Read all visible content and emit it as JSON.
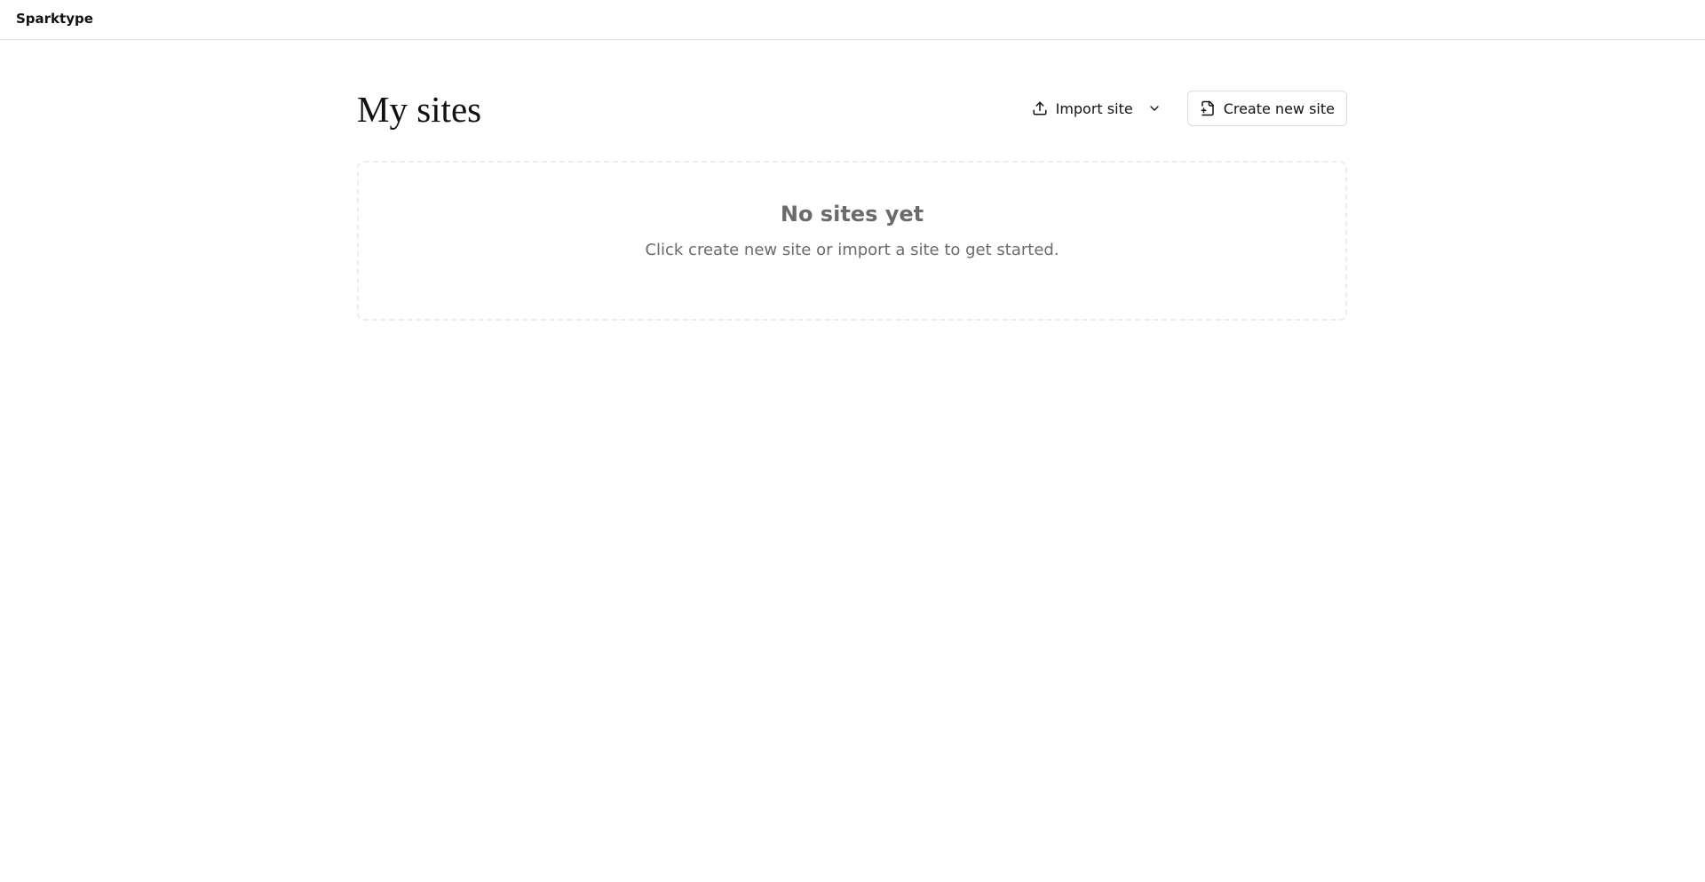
{
  "app": {
    "brand": "Sparktype"
  },
  "header": {
    "title": "My sites"
  },
  "actions": {
    "import_label": "Import site",
    "import_icon": "upload-icon",
    "import_menu_icon": "chevron-down-icon",
    "create_label": "Create new site",
    "create_icon": "file-plus-icon"
  },
  "empty_state": {
    "title": "No sites yet",
    "message": "Click create new site or import a site to get started."
  },
  "colors": {
    "text": "#111111",
    "muted": "#6b6b6b",
    "border": "#dcdcdc",
    "dashed_border": "#ececec"
  }
}
